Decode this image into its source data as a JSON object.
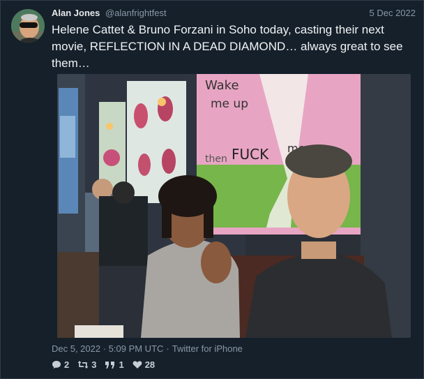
{
  "tweet": {
    "author_name": "Alan Jones",
    "author_handle": "@alanfrightfest",
    "date": "5 Dec 2022",
    "text": "Helene Cattet & Bruno Forzani in Soho today, casting their next movie, REFLECTION IN A DEAD DIAMOND… always great to see them…",
    "timestamp": "Dec 5, 2022 · 5:09 PM UTC",
    "separator": "·",
    "source": "Twitter for iPhone"
  },
  "photo": {
    "painting_text_1": "Wake",
    "painting_text_2": "me up",
    "painting_text_3": "then",
    "painting_text_4": "FUCK",
    "painting_text_5": "me up"
  },
  "stats": {
    "replies": "2",
    "retweets": "3",
    "quotes": "1",
    "likes": "28"
  },
  "icons": {
    "reply": "reply-icon",
    "retweet": "retweet-icon",
    "quote": "quote-icon",
    "like": "heart-icon"
  }
}
